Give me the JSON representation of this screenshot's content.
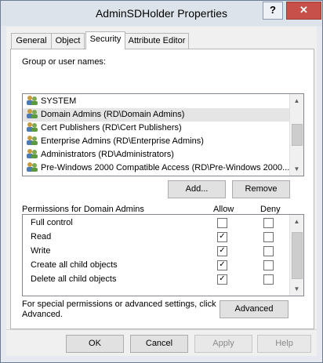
{
  "window": {
    "title": "AdminSDHolder Properties",
    "help_glyph": "?",
    "close_glyph": "✕"
  },
  "tabs": [
    {
      "label": "General"
    },
    {
      "label": "Object"
    },
    {
      "label": "Security"
    },
    {
      "label": "Attribute Editor"
    }
  ],
  "groups": {
    "label": "Group or user names:",
    "items": [
      {
        "label": "SYSTEM"
      },
      {
        "label": "Domain Admins (RD\\Domain Admins)"
      },
      {
        "label": "Cert Publishers (RD\\Cert Publishers)"
      },
      {
        "label": "Enterprise Admins (RD\\Enterprise Admins)"
      },
      {
        "label": "Administrators (RD\\Administrators)"
      },
      {
        "label": "Pre-Windows 2000 Compatible Access (RD\\Pre-Windows 2000..."
      }
    ],
    "add_label": "Add...",
    "remove_label": "Remove"
  },
  "permissions": {
    "label": "Permissions for Domain Admins",
    "allow_header": "Allow",
    "deny_header": "Deny",
    "rows": [
      {
        "name": "Full control",
        "allow": "",
        "deny": ""
      },
      {
        "name": "Read",
        "allow": "✓",
        "deny": ""
      },
      {
        "name": "Write",
        "allow": "✓",
        "deny": ""
      },
      {
        "name": "Create all child objects",
        "allow": "✓",
        "deny": ""
      },
      {
        "name": "Delete all child objects",
        "allow": "✓",
        "deny": ""
      }
    ]
  },
  "advanced": {
    "text": "For special permissions or advanced settings, click Advanced.",
    "button_label": "Advanced"
  },
  "footer": {
    "ok": "OK",
    "cancel": "Cancel",
    "apply": "Apply",
    "help": "Help"
  },
  "scroll": {
    "up": "▲",
    "down": "▼"
  }
}
